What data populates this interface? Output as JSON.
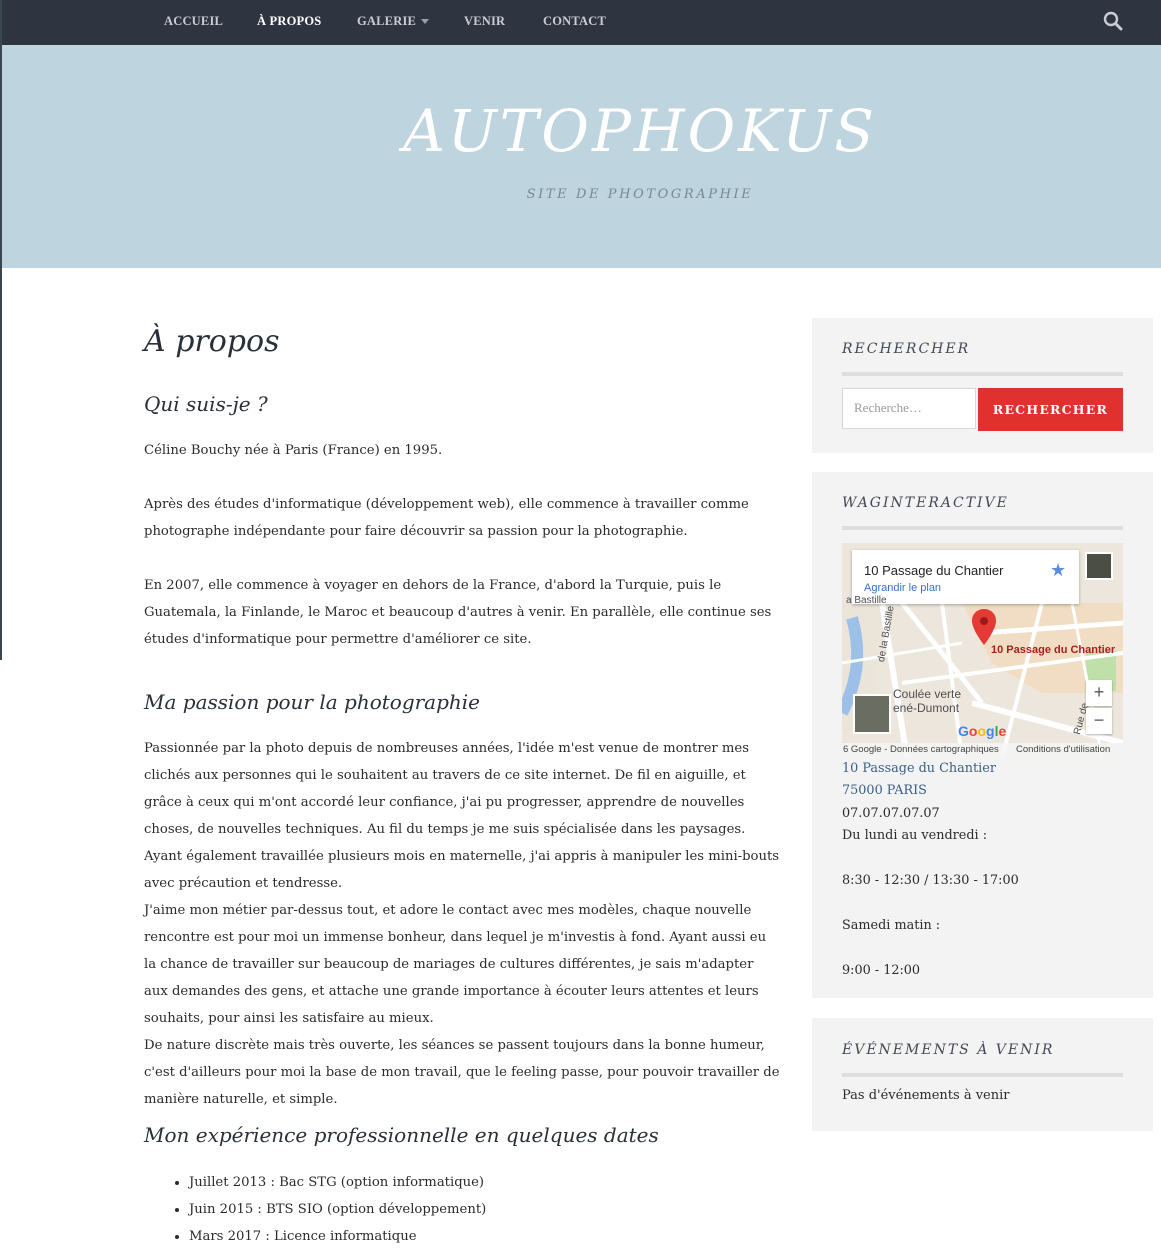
{
  "nav": {
    "items": [
      "ACCUEIL",
      "À PROPOS",
      "GALERIE",
      "VENIR",
      "CONTACT"
    ],
    "search_icon": "search-icon"
  },
  "header": {
    "title": "AUTOPHOKUS",
    "tagline": "SITE DE PHOTOGRAPHIE"
  },
  "main": {
    "title": "À propos",
    "section1": {
      "heading": "Qui suis-je ?",
      "p1": "Céline Bouchy née à Paris (France) en 1995.",
      "p2": "Après des études d'informatique (développement web), elle commence à travailler comme photographe indépendante pour faire découvrir sa passion pour la photographie.",
      "p3": "En 2007, elle commence à voyager en dehors de la France, d'abord la Turquie, puis le Guatemala, la Finlande, le Maroc et beaucoup d'autres à venir. En parallèle, elle continue ses études d'informatique pour permettre d'améliorer ce site."
    },
    "section2": {
      "heading": "Ma passion pour la photographie",
      "p1": "Passionnée par la photo depuis de nombreuses années, l'idée m'est venue de montrer mes clichés aux personnes qui le souhaitent au travers de ce site internet. De fil en aiguille, et grâce à ceux qui m'ont accordé leur confiance, j'ai pu progresser, apprendre de nouvelles choses, de nouvelles techniques. Au fil du temps je me suis spécialisée dans les paysages.",
      "p2": "Ayant également travaillée plusieurs mois en maternelle, j'ai appris à manipuler les mini-bouts avec précaution et tendresse.",
      "p3": "J'aime mon métier par-dessus tout, et adore le contact avec mes modèles, chaque nouvelle rencontre est pour moi un immense bonheur, dans lequel je m'investis à fond. Ayant aussi eu la chance de travailler sur beaucoup de mariages de cultures différentes, je sais m'adapter aux demandes des gens, et attache une grande importance à écouter leurs attentes et leurs souhaits, pour ainsi les satisfaire au mieux.",
      "p4": "De nature discrète mais très ouverte, les séances se passent toujours dans la bonne humeur, c'est d'ailleurs pour moi la base de mon travail, que le feeling passe, pour pouvoir travailler de manière naturelle, et simple."
    },
    "section3": {
      "heading": "Mon expérience professionnelle en quelques dates",
      "items": [
        "Juillet 2013 : Bac STG (option informatique)",
        "Juin 2015 : BTS SIO (option développement)",
        "Mars 2017 : Licence informatique"
      ]
    }
  },
  "sidebar": {
    "search": {
      "title": "RECHERCHER",
      "placeholder": "Recherche…",
      "button": "RECHERCHER"
    },
    "wag": {
      "title": "WAGINTERACTIVE",
      "map": {
        "place": "10 Passage du Chantier",
        "enlarge": "Agrandir le plan",
        "pin_label": "10 Passage du Chantier",
        "label_bastille": "a Bastille",
        "label_coulee1": "Coulée verte",
        "label_coulee2": "ené-Dumont",
        "label_de_la": "de la Bastille",
        "label_rue": "Rue de",
        "google": "Google",
        "footer_left": "6 Google - Données cartographiques",
        "footer_right": "Conditions d'utilisation",
        "zoom_in": "+",
        "zoom_out": "−"
      },
      "address1": "10 Passage du Chantier",
      "address2": "75000 PARIS",
      "phone": "07.07.07.07.07",
      "days": "Du lundi au vendredi :",
      "hours1": "8:30 - 12:30 / 13:30 - 17:00",
      "saturday": "Samedi matin :",
      "hours2": "9:00 - 12:00"
    },
    "events": {
      "title": "ÉVÉNEMENTS À VENIR",
      "text": "Pas d'événements à venir"
    }
  }
}
